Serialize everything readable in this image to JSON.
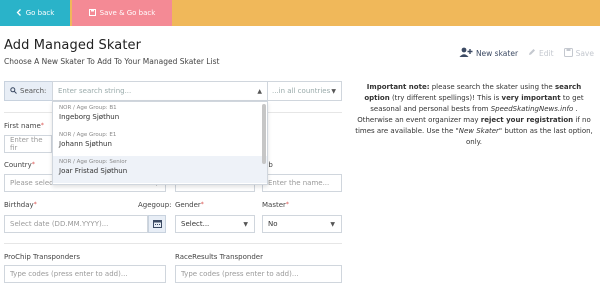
{
  "topbar": {
    "back_label": "Go back",
    "save_back_label": "Save & Go back"
  },
  "page": {
    "title": "Add Managed Skater",
    "subtitle": "Choose A New Skater To Add To Your Managed Skater List"
  },
  "actions": {
    "new_skater": "New skater",
    "edit": "Edit",
    "save": "Save"
  },
  "search": {
    "label": "Search:",
    "placeholder": "Enter search string...",
    "country": "...in all countries"
  },
  "results": [
    {
      "meta": "NOR / Age Group: B1",
      "name": "Ingeborg Sjøthun"
    },
    {
      "meta": "NOR / Age Group: E1",
      "name": "Johann Sjøthun"
    },
    {
      "meta": "NOR / Age Group: Senior",
      "name": "Joar Fristad Sjøthun"
    }
  ],
  "form": {
    "first_name_label": "First name",
    "first_name_placeholder": "Enter the fir",
    "country_label": "Country",
    "country_placeholder": "Please select...",
    "gender_placeholder": "Enter the name...",
    "club_label": "lub",
    "club_placeholder": "Enter the name...",
    "birthday_label": "Birthday",
    "birthday_placeholder": "Select date (DD.MM.YYYY)...",
    "agegroup_label": "Agegoup:",
    "gender_label": "Gender",
    "gender_select": "Select...",
    "master_label": "Master",
    "master_select": "No",
    "proochip_label": "ProChip Transponders",
    "proochip_placeholder": "Type codes (press enter to add)...",
    "raceresults_label": "RaceResults Transponder",
    "raceresults_placeholder": "Type codes (press enter to add)..."
  },
  "note": {
    "lead": "Important note:",
    "t1": " please search the skater using the ",
    "b1": "search option",
    "t2": " (try different spellings)! This is ",
    "b2": "very important",
    "t3": " to get seasonal and personal bests from ",
    "i1": "SpeedSkatingNews.info",
    "t4": " . Otherwise an event organizer may ",
    "b3": "reject your registration",
    "t5": " if no times are available. Use the ",
    "i2": "\"New Skater\"",
    "t6": " button as the last option, only."
  },
  "colors": {
    "topbar": "#f0b85a",
    "back": "#2ab3c9",
    "save_back": "#f48a95"
  }
}
